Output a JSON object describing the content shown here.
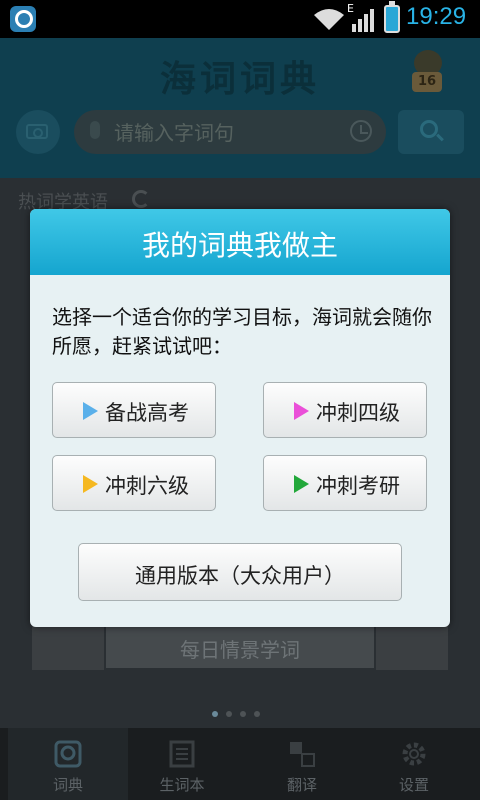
{
  "status_bar": {
    "time": "19:29",
    "network_label": "E",
    "icons": [
      "app-icon",
      "wifi-icon",
      "signal-icon",
      "battery-icon"
    ]
  },
  "header": {
    "title": "海词词典",
    "badge_number": "16"
  },
  "search": {
    "placeholder": "请输入字词句"
  },
  "hot_words": {
    "label": "热词学英语"
  },
  "daily": {
    "caption": "每日情景学词"
  },
  "bottom_nav": {
    "tabs": [
      {
        "label": "词典",
        "icon": "dictionary-icon",
        "active": true
      },
      {
        "label": "生词本",
        "icon": "wordbook-icon",
        "active": false
      },
      {
        "label": "翻译",
        "icon": "translate-icon",
        "active": false
      },
      {
        "label": "设置",
        "icon": "gear-icon",
        "active": false
      }
    ]
  },
  "dialog": {
    "title": "我的词典我做主",
    "message": "选择一个适合你的学习目标，海词就会随你所愿，赶紧试试吧：",
    "options": [
      {
        "label": "备战高考",
        "color": "#5ab0ea"
      },
      {
        "label": "冲刺四级",
        "color": "#ea4fd8"
      },
      {
        "label": "冲刺六级",
        "color": "#f5b820"
      },
      {
        "label": "冲刺考研",
        "color": "#22a83a"
      }
    ],
    "general_button": "通用版本（大众用户）"
  },
  "colors": {
    "accent": "#29b3e6",
    "dialog_header": "#22aed6"
  }
}
